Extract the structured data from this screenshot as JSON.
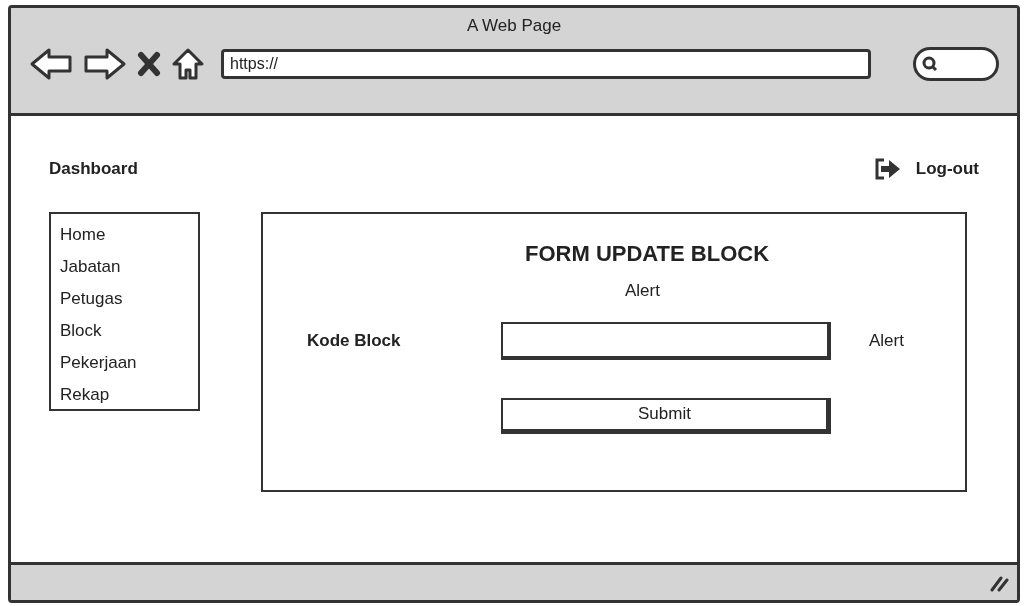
{
  "window": {
    "title": "A Web Page"
  },
  "address_bar": {
    "value": "https://"
  },
  "header": {
    "title": "Dashboard",
    "logout": "Log-out"
  },
  "sidebar": {
    "items": [
      "Home",
      "Jabatan",
      "Petugas",
      "Block",
      "Pekerjaan",
      "Rekap"
    ]
  },
  "form": {
    "title": "FORM UPDATE BLOCK",
    "alert": "Alert",
    "field_label": "Kode Block",
    "field_alert": "Alert",
    "submit": "Submit"
  }
}
